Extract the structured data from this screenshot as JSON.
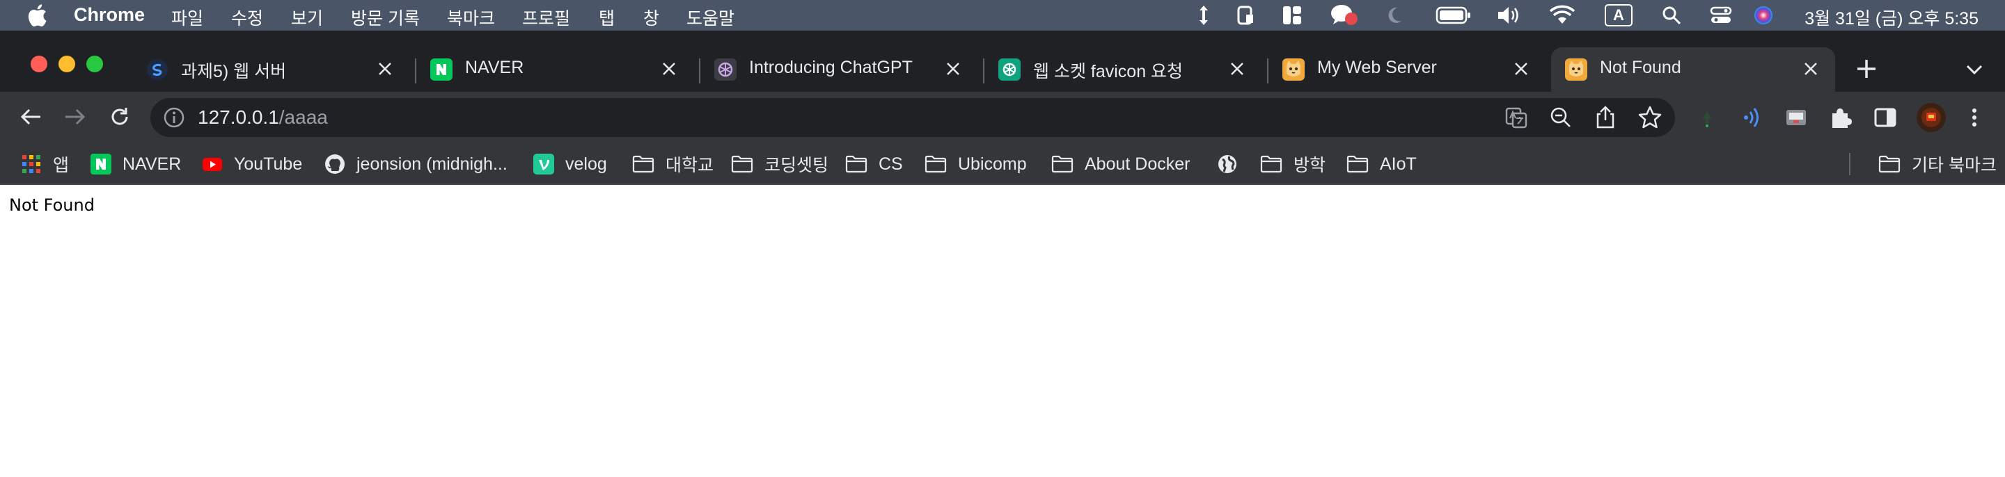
{
  "menubar": {
    "app_name": "Chrome",
    "menus": [
      "파일",
      "수정",
      "보기",
      "방문 기록",
      "북마크",
      "프로필",
      "탭",
      "창",
      "도움말"
    ],
    "clock": "3월 31일 (금) 오후 5:35",
    "input_source": "A",
    "status_icons": [
      "resize-arrows-icon",
      "clipboard-icon",
      "stage-manager-icon",
      "messages-icon",
      "moon-icon",
      "battery-icon",
      "volume-icon",
      "wifi-icon",
      "input-source-icon",
      "spotlight-icon",
      "control-center-icon",
      "siri-icon"
    ]
  },
  "tabs": [
    {
      "title": "과제5) 웹 서버",
      "favicon": "sdot-favicon",
      "color": "#1d2b45"
    },
    {
      "title": "NAVER",
      "favicon": "naver-favicon",
      "color": "#03c75a"
    },
    {
      "title": "Introducing ChatGPT",
      "favicon": "openai-favicon",
      "color": "#3c3c44"
    },
    {
      "title": "웹 소켓 favicon 요청",
      "favicon": "chatgpt-favicon",
      "color": "#10a37f"
    },
    {
      "title": "My Web Server",
      "favicon": "cat-favicon",
      "color": "#f2a93b"
    },
    {
      "title": "Not Found",
      "favicon": "cat-favicon",
      "color": "#f2a93b",
      "active": true
    }
  ],
  "omnibox": {
    "host": "127.0.0.1",
    "path": "/aaaa"
  },
  "bookmarks": [
    {
      "label": "앱",
      "icon": "apps-grid-icon"
    },
    {
      "label": "NAVER",
      "icon": "naver-icon"
    },
    {
      "label": "YouTube",
      "icon": "youtube-icon"
    },
    {
      "label": "jeonsion (midnigh...",
      "icon": "github-icon"
    },
    {
      "label": "velog",
      "icon": "velog-icon"
    },
    {
      "label": "대학교",
      "icon": "folder-icon"
    },
    {
      "label": "코딩셋팅",
      "icon": "folder-icon"
    },
    {
      "label": "CS",
      "icon": "folder-icon"
    },
    {
      "label": "Ubicomp",
      "icon": "folder-icon"
    },
    {
      "label": "About Docker",
      "icon": "folder-icon"
    },
    {
      "label": "",
      "icon": "globe-icon"
    },
    {
      "label": "방학",
      "icon": "folder-icon"
    },
    {
      "label": "AIoT",
      "icon": "folder-icon"
    },
    {
      "label": "기타 북마크",
      "icon": "folder-icon"
    }
  ],
  "page": {
    "text": "Not Found"
  },
  "colors": {
    "menubar_bg": "#4a5567",
    "tabstrip_bg": "#202124",
    "toolbar_bg": "#35363a",
    "omnibox_bg": "#202124",
    "close_red": "#ff5f57",
    "minimize_yellow": "#febc2e",
    "zoom_green": "#28c840",
    "accent_blue": "#8ab4f8"
  }
}
